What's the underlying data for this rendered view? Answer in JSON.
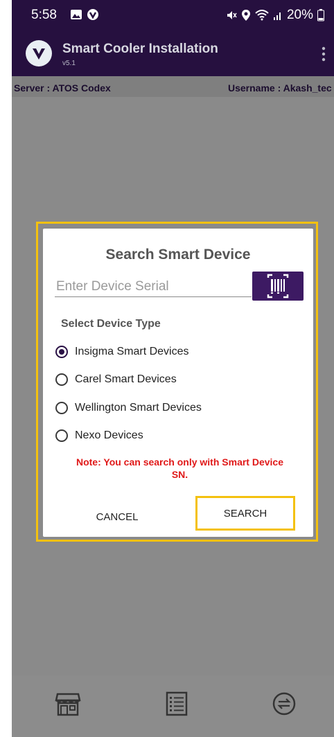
{
  "status_bar": {
    "time": "5:58",
    "left_icons": [
      "gallery-icon",
      "vpn-shield-icon"
    ],
    "right_icons": [
      "mute-icon",
      "location-icon",
      "wifi-icon",
      "signal-icon"
    ],
    "battery": "20%"
  },
  "app_bar": {
    "title": "Smart Cooler Installation",
    "version": "v5.1",
    "menu_icon": "more-vert-icon"
  },
  "info_bar": {
    "server": "Server : ATOS Codex",
    "username": "Username : Akash_tec"
  },
  "dialog": {
    "title": "Search Smart Device",
    "serial_placeholder": "Enter Device Serial",
    "scan_icon": "barcode-scan-icon",
    "device_type_label": "Select Device Type",
    "options": [
      {
        "label": "Insigma Smart Devices",
        "selected": true
      },
      {
        "label": "Carel Smart Devices",
        "selected": false
      },
      {
        "label": "Wellington Smart Devices",
        "selected": false
      },
      {
        "label": "Nexo Devices",
        "selected": false
      }
    ],
    "note_line1": "Note: You can search only with Smart Device",
    "note_line2": "SN.",
    "cancel_label": "CANCEL",
    "search_label": "SEARCH"
  },
  "bottom_nav": {
    "items": [
      "store-icon",
      "list-icon",
      "sync-icon"
    ]
  },
  "colors": {
    "header": "#26103f",
    "highlight": "#f4c10f",
    "note": "#e01919",
    "accent": "#3d1a63"
  }
}
